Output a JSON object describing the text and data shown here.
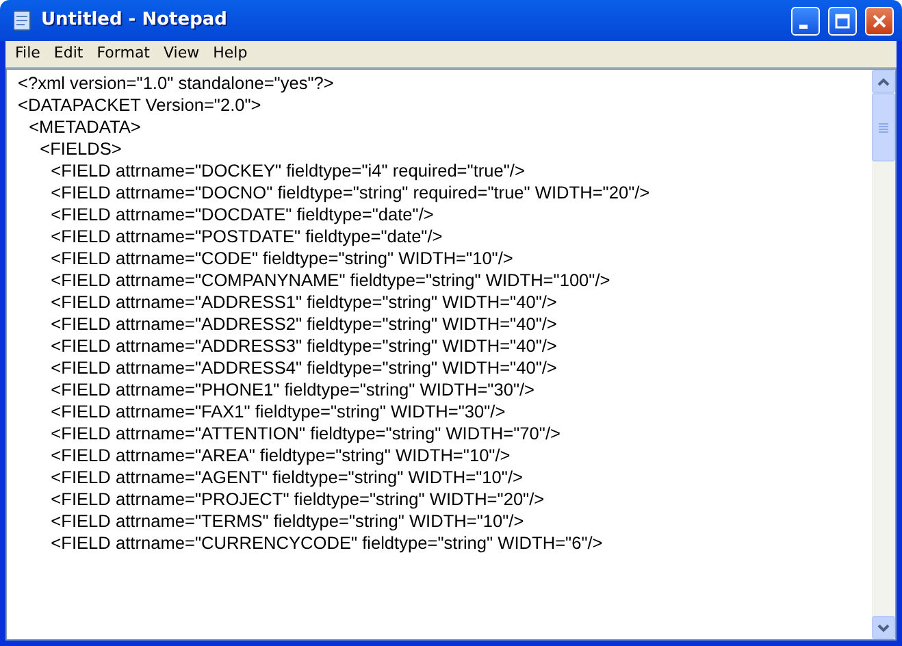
{
  "window": {
    "title": "Untitled - Notepad"
  },
  "menu": [
    "File",
    "Edit",
    "Format",
    "View",
    "Help"
  ],
  "editor": {
    "lines": [
      "<?xml version=\"1.0\" standalone=\"yes\"?>",
      "<DATAPACKET Version=\"2.0\">",
      " <METADATA>",
      "  <FIELDS>",
      "   <FIELD attrname=\"DOCKEY\" fieldtype=\"i4\" required=\"true\"/>",
      "   <FIELD attrname=\"DOCNO\" fieldtype=\"string\" required=\"true\" WIDTH=\"20\"/>",
      "   <FIELD attrname=\"DOCDATE\" fieldtype=\"date\"/>",
      "   <FIELD attrname=\"POSTDATE\" fieldtype=\"date\"/>",
      "   <FIELD attrname=\"CODE\" fieldtype=\"string\" WIDTH=\"10\"/>",
      "   <FIELD attrname=\"COMPANYNAME\" fieldtype=\"string\" WIDTH=\"100\"/>",
      "   <FIELD attrname=\"ADDRESS1\" fieldtype=\"string\" WIDTH=\"40\"/>",
      "   <FIELD attrname=\"ADDRESS2\" fieldtype=\"string\" WIDTH=\"40\"/>",
      "   <FIELD attrname=\"ADDRESS3\" fieldtype=\"string\" WIDTH=\"40\"/>",
      "   <FIELD attrname=\"ADDRESS4\" fieldtype=\"string\" WIDTH=\"40\"/>",
      "   <FIELD attrname=\"PHONE1\" fieldtype=\"string\" WIDTH=\"30\"/>",
      "   <FIELD attrname=\"FAX1\" fieldtype=\"string\" WIDTH=\"30\"/>",
      "   <FIELD attrname=\"ATTENTION\" fieldtype=\"string\" WIDTH=\"70\"/>",
      "   <FIELD attrname=\"AREA\" fieldtype=\"string\" WIDTH=\"10\"/>",
      "   <FIELD attrname=\"AGENT\" fieldtype=\"string\" WIDTH=\"10\"/>",
      "   <FIELD attrname=\"PROJECT\" fieldtype=\"string\" WIDTH=\"20\"/>",
      "   <FIELD attrname=\"TERMS\" fieldtype=\"string\" WIDTH=\"10\"/>",
      "   <FIELD attrname=\"CURRENCYCODE\" fieldtype=\"string\" WIDTH=\"6\"/>"
    ]
  }
}
